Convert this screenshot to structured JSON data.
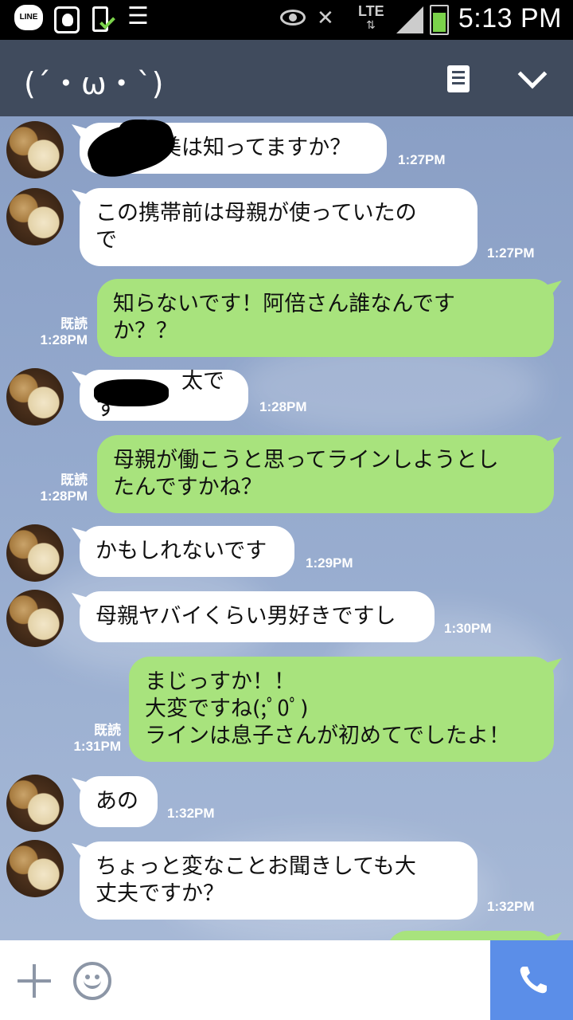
{
  "status_bar": {
    "line_badge": "LINE",
    "lte": "LTE",
    "time": "5:13 PM"
  },
  "header": {
    "title": "(´・ω・`)"
  },
  "messages": [
    {
      "side": "in",
      "lines": [
        "　　　美は知ってますか？"
      ],
      "time": "1:27PM"
    },
    {
      "side": "in",
      "lines": [
        "この携帯前は母親が使っていたの",
        "で"
      ],
      "time": "1:27PM"
    },
    {
      "side": "out",
      "lines": [
        "知らないです！阿倍さん誰なんです",
        "か？？"
      ],
      "read": "既読",
      "time": "1:28PM"
    },
    {
      "side": "in",
      "lines": [
        "　　　　太です"
      ],
      "time": "1:28PM"
    },
    {
      "side": "out",
      "lines": [
        "母親が働こうと思ってラインしようとし",
        "たんですかね？"
      ],
      "read": "既読",
      "time": "1:28PM"
    },
    {
      "side": "in",
      "lines": [
        "かもしれないです"
      ],
      "time": "1:29PM"
    },
    {
      "side": "in",
      "lines": [
        "母親ヤバイくらい男好きですし"
      ],
      "time": "1:30PM"
    },
    {
      "side": "out",
      "lines": [
        "まじっすか！！",
        "大変ですね(;ﾟ0ﾟ)",
        "ラインは息子さんが初めてでしたよ！"
      ],
      "read": "既読",
      "time": "1:31PM"
    },
    {
      "side": "in",
      "lines": [
        "あの"
      ],
      "time": "1:32PM"
    },
    {
      "side": "in",
      "lines": [
        "ちょっと変なことお聞きしても大",
        "丈夫ですか？"
      ],
      "time": "1:32PM"
    }
  ],
  "colors": {
    "header_bg": "#404b5d",
    "incoming_bubble": "#ffffff",
    "outgoing_bubble": "#a8e37d",
    "call_button": "#5b8ee8"
  },
  "icons": [
    "plus-icon",
    "smile-icon",
    "phone-icon",
    "note-icon",
    "chevron-down-icon"
  ]
}
